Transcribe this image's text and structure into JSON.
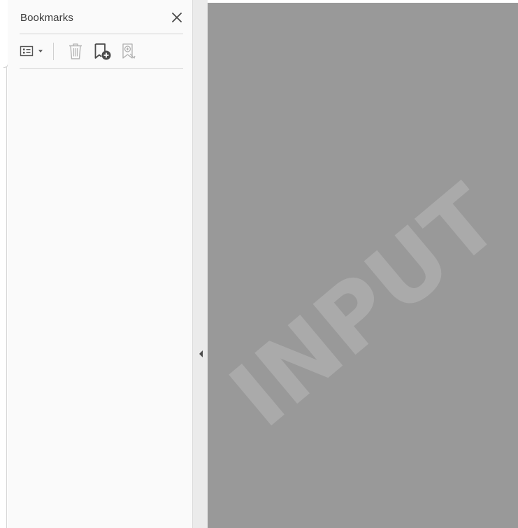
{
  "bookmarks_panel": {
    "title": "Bookmarks",
    "icons": {
      "close": "close-icon",
      "options": "bookmark-options-icon",
      "options_caret": "chevron-down-icon",
      "delete": "trash-icon",
      "new_bookmark": "add-bookmark-icon",
      "new_from_structure": "bookmark-from-structure-icon"
    }
  },
  "splitter": {
    "collapse_icon": "chevron-left-icon"
  },
  "document": {
    "watermark_text": "INPUT",
    "background_color": "#999999",
    "watermark_color": "#aaaaaa"
  }
}
